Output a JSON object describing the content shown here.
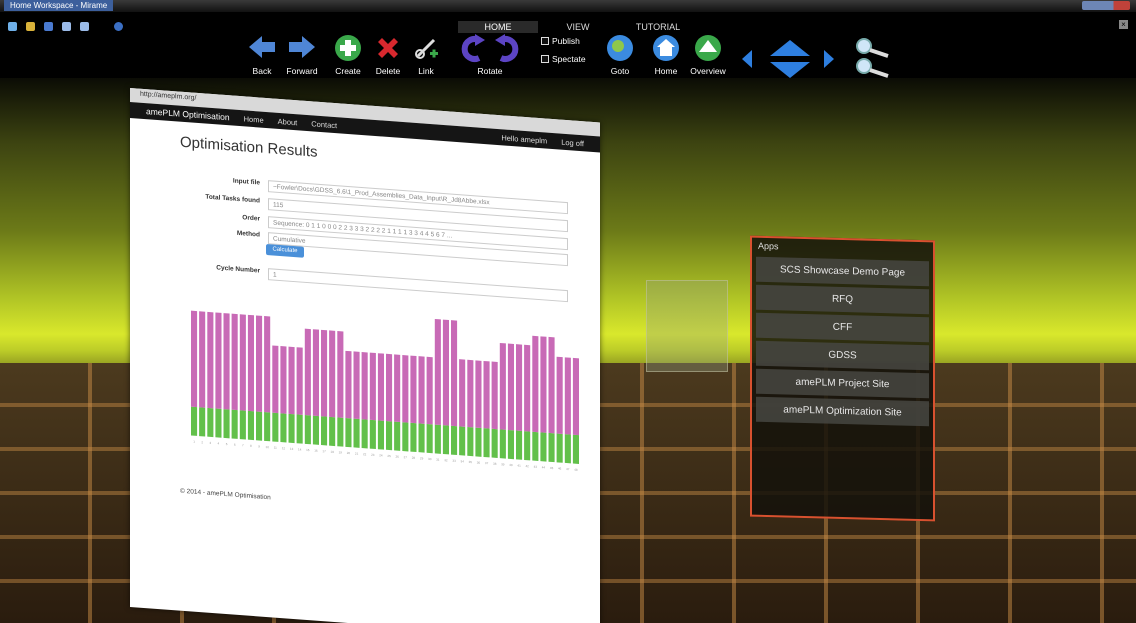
{
  "window": {
    "title": "Home Workspace - Mirame"
  },
  "tabs": [
    {
      "label": "HOME",
      "active": true
    },
    {
      "label": "VIEW",
      "active": false
    },
    {
      "label": "TUTORIAL",
      "active": false
    }
  ],
  "toolbar": {
    "back": "Back",
    "forward": "Forward",
    "create": "Create",
    "delete": "Delete",
    "link": "Link",
    "rotate": "Rotate",
    "publish": "Publish",
    "spectate": "Spectate",
    "goto": "Goto",
    "home": "Home",
    "overview": "Overview"
  },
  "colors": {
    "back": "#4f86d6",
    "create": "#3aa84a",
    "delete": "#d8282e",
    "rotate": "#5c44c4",
    "accent": "#d8512f"
  },
  "apps_panel": {
    "header": "Apps",
    "items": [
      "SCS Showcase Demo Page",
      "RFQ",
      "CFF",
      "GDSS",
      "amePLM Project Site",
      "amePLM Optimization Site"
    ]
  },
  "browser": {
    "url": "http://ameplm.org/",
    "brand": "amePLM Optimisation",
    "nav": [
      "Home",
      "About",
      "Contact"
    ],
    "nav_right": [
      "Hello ameplm",
      "Log off"
    ],
    "page_title": "Optimisation Results",
    "fields": [
      {
        "label": "Input file",
        "value": "~Fowler\\Docs\\GDSS_6.6\\1_Prod_Assemblies_Data_Input\\R_Jd8Abbe.xlsx"
      },
      {
        "label": "Total Tasks found",
        "value": "115"
      },
      {
        "label": "Order",
        "value": "Sequence: 0 1 1 0 0 0 2 2 3 3 3 2 2 2 2 1 1 1 1 3 3 4 4 5 6 7 ..."
      },
      {
        "label": "Method",
        "value": "Cumulative"
      }
    ],
    "calculate": "Calculate",
    "cycle_label": "Cycle Number",
    "cycle_value": "1",
    "footer": "© 2014 - amePLM Optimisation"
  },
  "chart_data": {
    "type": "bar",
    "categories": [
      "1",
      "2",
      "3",
      "4",
      "5",
      "6",
      "7",
      "8",
      "9",
      "10",
      "11",
      "12",
      "13",
      "14",
      "15",
      "16",
      "17",
      "18",
      "19",
      "20",
      "21",
      "22",
      "23",
      "24",
      "25",
      "26",
      "27",
      "28",
      "29",
      "30",
      "31",
      "32",
      "33",
      "34",
      "35",
      "36",
      "37",
      "38",
      "39",
      "40",
      "41",
      "42",
      "43",
      "44",
      "45",
      "46",
      "47",
      "48"
    ],
    "series": [
      {
        "color": "#62c04a",
        "values": [
          30,
          30,
          30,
          30,
          30,
          30,
          30,
          30,
          30,
          30,
          30,
          30,
          30,
          30,
          30,
          30,
          30,
          30,
          30,
          30,
          30,
          30,
          30,
          30,
          30,
          30,
          30,
          30,
          30,
          30,
          30,
          30,
          30,
          30,
          30,
          30,
          30,
          30,
          30,
          30,
          30,
          30,
          30,
          30,
          30,
          30,
          30,
          30
        ]
      },
      {
        "color": "#c86ab6",
        "values": [
          100,
          100,
          100,
          100,
          100,
          100,
          100,
          100,
          100,
          100,
          70,
          70,
          70,
          70,
          90,
          90,
          90,
          90,
          90,
          70,
          70,
          70,
          70,
          70,
          70,
          70,
          70,
          70,
          70,
          70,
          110,
          110,
          110,
          70,
          70,
          70,
          70,
          70,
          90,
          90,
          90,
          90,
          100,
          100,
          100,
          80,
          80,
          80
        ]
      }
    ]
  }
}
